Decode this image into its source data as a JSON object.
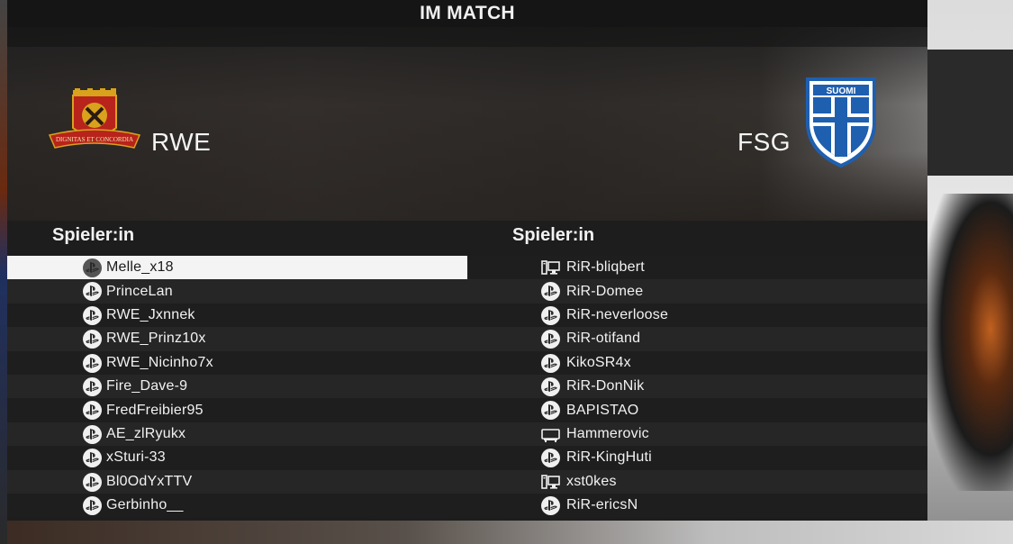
{
  "title": "IM MATCH",
  "home": {
    "name": "RWE",
    "crest_motto": "DIGNITAS ET CONCORDIA",
    "header": "Spieler:in",
    "players": [
      {
        "name": "Melle_x18",
        "platform": "playstation-icon",
        "selected": true
      },
      {
        "name": "PrinceLan",
        "platform": "playstation-icon"
      },
      {
        "name": "RWE_Jxnnek",
        "platform": "playstation-icon"
      },
      {
        "name": "RWE_Prinz10x",
        "platform": "playstation-icon"
      },
      {
        "name": "RWE_Nicinho7x",
        "platform": "playstation-icon"
      },
      {
        "name": "Fire_Dave-9",
        "platform": "playstation-icon"
      },
      {
        "name": "FredFreibier95",
        "platform": "playstation-icon"
      },
      {
        "name": "AE_zlRyukx",
        "platform": "playstation-icon"
      },
      {
        "name": "xSturi-33",
        "platform": "playstation-icon"
      },
      {
        "name": "Bl0OdYxTTV",
        "platform": "playstation-icon"
      },
      {
        "name": "Gerbinho__",
        "platform": "playstation-icon"
      }
    ]
  },
  "away": {
    "name": "FSG",
    "crest_text": "SUOMI",
    "header": "Spieler:in",
    "players": [
      {
        "name": "RiR-bliqbert",
        "platform": "pc-icon"
      },
      {
        "name": "RiR-Domee",
        "platform": "playstation-icon"
      },
      {
        "name": "RiR-neverloose",
        "platform": "playstation-icon"
      },
      {
        "name": "RiR-otifand",
        "platform": "playstation-icon"
      },
      {
        "name": "KikoSR4x",
        "platform": "playstation-icon"
      },
      {
        "name": "RiR-DonNik",
        "platform": "playstation-icon"
      },
      {
        "name": "BAPISTAO",
        "platform": "playstation-icon"
      },
      {
        "name": "Hammerovic",
        "platform": "xbox-console-icon"
      },
      {
        "name": "RiR-KingHuti",
        "platform": "playstation-icon"
      },
      {
        "name": "xst0kes",
        "platform": "pc-icon"
      },
      {
        "name": "RiR-ericsN",
        "platform": "playstation-icon"
      }
    ]
  },
  "colors": {
    "home_red": "#b8231b",
    "home_gold": "#d9a21c",
    "away_blue": "#1f5fb0",
    "selected_row": "#f4f4f4"
  }
}
